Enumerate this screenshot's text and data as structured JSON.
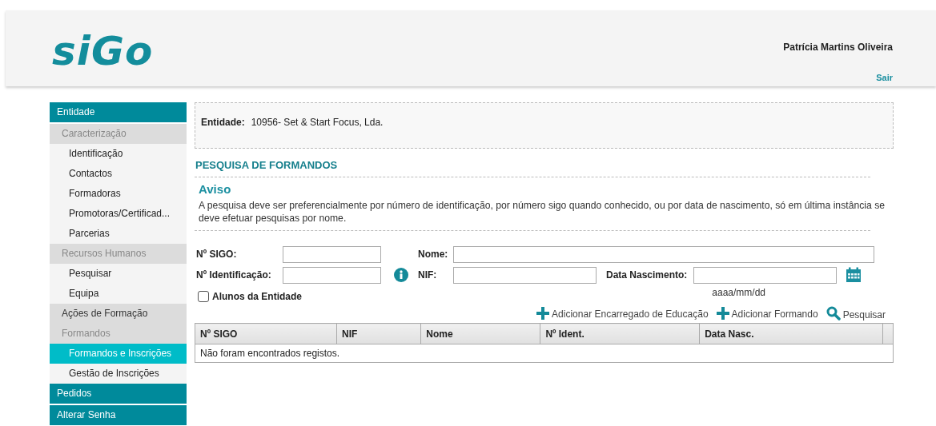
{
  "header": {
    "logo": "siGo",
    "user_name": "Patrícia Martins Oliveira",
    "logout": "Sair"
  },
  "sidebar": {
    "sections": [
      {
        "label": "Entidade",
        "children": [
          {
            "label": "Caracterização",
            "muted": true,
            "children": [
              {
                "label": "Identificação",
                "selected": false
              },
              {
                "label": "Contactos",
                "selected": false
              },
              {
                "label": "Formadoras",
                "selected": false
              },
              {
                "label": "Promotoras/Certificad...",
                "selected": false
              },
              {
                "label": "Parcerias",
                "selected": false
              }
            ]
          },
          {
            "label": "Recursos Humanos",
            "muted": true,
            "children": [
              {
                "label": "Pesquisar",
                "selected": false
              },
              {
                "label": "Equipa",
                "selected": false
              }
            ]
          },
          {
            "label": "Ações de Formação",
            "muted": false
          },
          {
            "label": "Formandos",
            "muted": true,
            "children": [
              {
                "label": "Formandos e Inscrições",
                "selected": true
              },
              {
                "label": "Gestão de Inscrições",
                "selected": false
              }
            ]
          }
        ]
      },
      {
        "label": "Pedidos"
      },
      {
        "label": "Alterar Senha"
      }
    ]
  },
  "entity": {
    "label": "Entidade:",
    "value": "10956- Set & Start Focus, Lda."
  },
  "search": {
    "title": "PESQUISA DE FORMANDOS",
    "notice_title": "Aviso",
    "notice_text": "A pesquisa deve ser preferencialmente por número de identificação, por número sigo quando conhecido, ou por data de nascimento, só em última instância se deve efetuar pesquisas por nome.",
    "fields": {
      "sigo": "Nº SIGO:",
      "name": "Nome:",
      "id": "Nº Identificação:",
      "nif": "NIF:",
      "birth": "Data Nascimento:",
      "birth_hint": "aaaa/mm/dd"
    },
    "checkbox": {
      "label": "Alunos da Entidade",
      "checked": false
    },
    "actions": [
      {
        "kind": "add",
        "label": "Adicionar Encarregado de Educação"
      },
      {
        "kind": "add",
        "label": "Adicionar Formando"
      },
      {
        "kind": "search",
        "label": "Pesquisar"
      }
    ]
  },
  "table": {
    "columns": [
      "Nº SIGO",
      "NIF",
      "Nome",
      "Nº Ident.",
      "Data Nasc."
    ],
    "empty_message": "Não foram encontrados registos."
  }
}
